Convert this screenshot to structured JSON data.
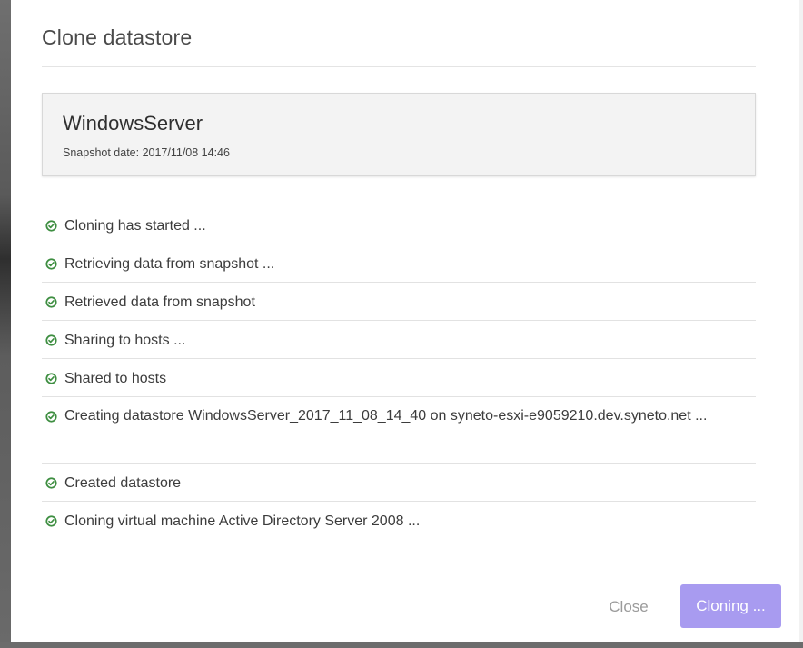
{
  "dialog": {
    "title": "Clone datastore"
  },
  "snapshot": {
    "name": "WindowsServer",
    "date_text": "Snapshot date: 2017/11/08 14:46"
  },
  "steps": [
    {
      "icon": "check-circle-icon",
      "text": "Cloning has started ..."
    },
    {
      "icon": "check-circle-icon",
      "text": "Retrieving data from snapshot ..."
    },
    {
      "icon": "check-circle-icon",
      "text": "Retrieved data from snapshot"
    },
    {
      "icon": "check-circle-icon",
      "text": "Sharing to hosts ..."
    },
    {
      "icon": "check-circle-icon",
      "text": "Shared to hosts"
    },
    {
      "icon": "check-circle-icon",
      "text": "Creating datastore WindowsServer_2017_11_08_14_40 on syneto-esxi-e9059210.dev.syneto.net ..."
    },
    {
      "icon": "check-circle-icon",
      "text": "Created datastore"
    },
    {
      "icon": "check-circle-icon",
      "text": "Cloning virtual machine Active Directory Server 2008 ..."
    }
  ],
  "footer": {
    "close_label": "Close",
    "cloning_label": "Cloning ..."
  },
  "colors": {
    "success": "#3e8e41",
    "primary_button_disabled": "#a89bf0",
    "close_text": "#9b9b9b"
  }
}
